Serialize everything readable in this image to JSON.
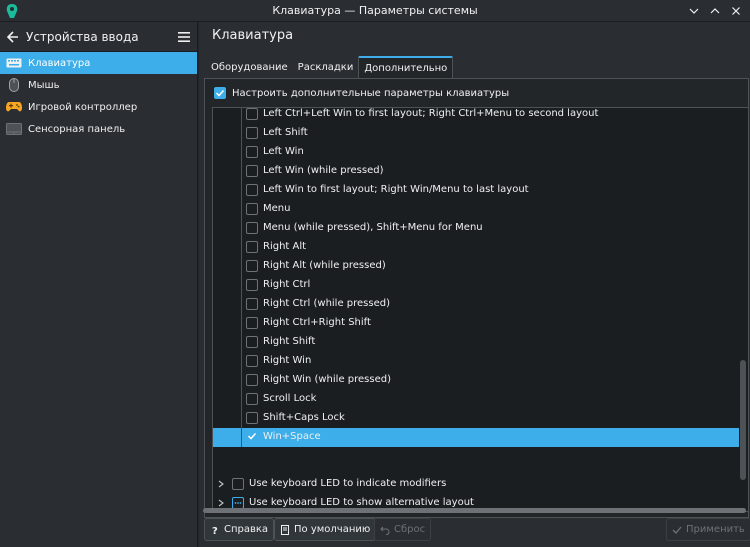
{
  "window": {
    "title": "Клавиатура — Параметры системы"
  },
  "sidebar": {
    "title": "Устройства ввода",
    "items": [
      {
        "label": "Клавиатура",
        "icon": "keyboard-icon"
      },
      {
        "label": "Мышь",
        "icon": "mouse-icon"
      },
      {
        "label": "Игровой контроллер",
        "icon": "gamepad-icon"
      },
      {
        "label": "Сенсорная панель",
        "icon": "touchpad-icon"
      }
    ]
  },
  "main": {
    "title": "Клавиатура",
    "tabs": [
      {
        "label": "Оборудование"
      },
      {
        "label": "Раскладки"
      },
      {
        "label": "Дополнительно"
      }
    ],
    "configure_label": "Настроить дополнительные параметры клавиатуры",
    "options": [
      {
        "label": "Left Ctrl+Left Win to first layout; Right Ctrl+Menu to second layout",
        "checked": false
      },
      {
        "label": "Left Shift",
        "checked": false
      },
      {
        "label": "Left Win",
        "checked": false
      },
      {
        "label": "Left Win (while pressed)",
        "checked": false
      },
      {
        "label": "Left Win to first layout; Right Win/Menu to last layout",
        "checked": false
      },
      {
        "label": "Menu",
        "checked": false
      },
      {
        "label": "Menu (while pressed), Shift+Menu for Menu",
        "checked": false
      },
      {
        "label": "Right Alt",
        "checked": false
      },
      {
        "label": "Right Alt (while pressed)",
        "checked": false
      },
      {
        "label": "Right Ctrl",
        "checked": false
      },
      {
        "label": "Right Ctrl (while pressed)",
        "checked": false
      },
      {
        "label": "Right Ctrl+Right Shift",
        "checked": false
      },
      {
        "label": "Right Shift",
        "checked": false
      },
      {
        "label": "Right Win",
        "checked": false
      },
      {
        "label": "Right Win (while pressed)",
        "checked": false
      },
      {
        "label": "Scroll Lock",
        "checked": false
      },
      {
        "label": "Shift+Caps Lock",
        "checked": false
      },
      {
        "label": "Win+Space",
        "checked": true
      }
    ],
    "groups": [
      {
        "label": "Use keyboard LED to indicate modifiers"
      },
      {
        "label": "Use keyboard LED to show alternative layout"
      }
    ]
  },
  "buttons": {
    "help": "Справка",
    "defaults": "По умолчанию",
    "reset": "Сброс",
    "apply": "Применить"
  },
  "colors": {
    "accent": "#3daee9",
    "background": "#232629"
  }
}
